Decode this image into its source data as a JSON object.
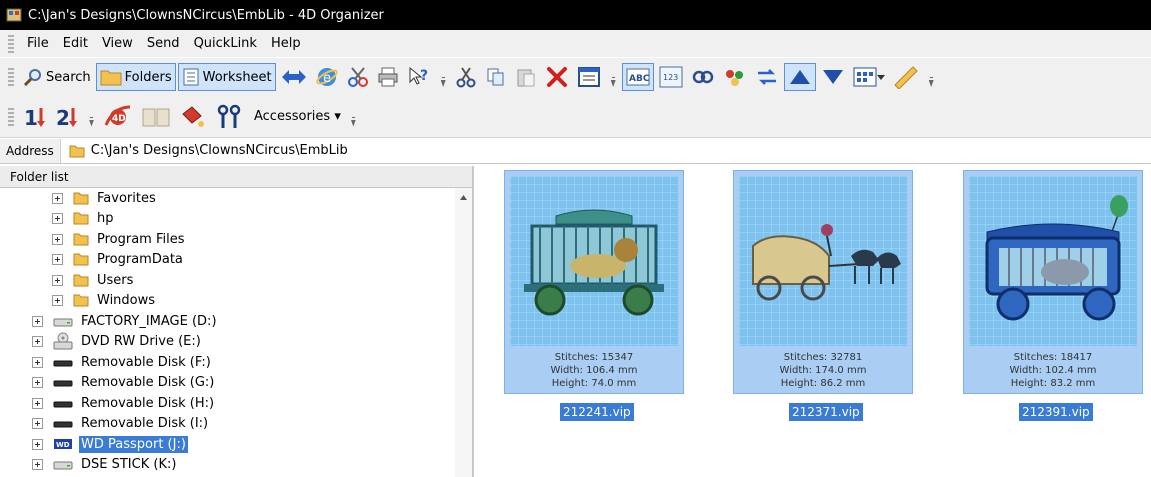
{
  "window": {
    "title": "C:\\Jan's Designs\\ClownsNCircus\\EmbLib - 4D Organizer"
  },
  "menu": [
    "File",
    "Edit",
    "View",
    "Send",
    "QuickLink",
    "Help"
  ],
  "toolbar": {
    "search_label": "Search",
    "folders_label": "Folders",
    "worksheet_label": "Worksheet",
    "accessories_label": "Accessories ▾"
  },
  "address": {
    "label": "Address",
    "value": "C:\\Jan's Designs\\ClownsNCircus\\EmbLib"
  },
  "folder_list": {
    "header": "Folder list",
    "items": [
      {
        "label": "Favorites",
        "icon": "folder-icon"
      },
      {
        "label": "hp",
        "icon": "folder-icon"
      },
      {
        "label": "Program Files",
        "icon": "folder-icon"
      },
      {
        "label": "ProgramData",
        "icon": "folder-icon"
      },
      {
        "label": "Users",
        "icon": "folder-icon"
      },
      {
        "label": "Windows",
        "icon": "folder-icon"
      },
      {
        "label": "FACTORY_IMAGE (D:)",
        "icon": "drive-icon"
      },
      {
        "label": "DVD RW Drive (E:)",
        "icon": "dvd-drive-icon"
      },
      {
        "label": "Removable Disk (F:)",
        "icon": "removable-disk-icon"
      },
      {
        "label": "Removable Disk (G:)",
        "icon": "removable-disk-icon"
      },
      {
        "label": "Removable Disk (H:)",
        "icon": "removable-disk-icon"
      },
      {
        "label": "Removable Disk (I:)",
        "icon": "removable-disk-icon"
      },
      {
        "label": "WD Passport (J:)",
        "icon": "wd-drive-icon",
        "selected": true
      },
      {
        "label": "DSE STICK (K:)",
        "icon": "drive-icon"
      }
    ]
  },
  "designs": [
    {
      "file": "212241.vip",
      "stitches": "Stitches: 15347",
      "width": "Width: 106.4 mm",
      "height": "Height: 74.0 mm",
      "subject": "lion-cage-wagon"
    },
    {
      "file": "212371.vip",
      "stitches": "Stitches: 32781",
      "width": "Width: 174.0 mm",
      "height": "Height: 86.2 mm",
      "subject": "horse-drawn-carriage"
    },
    {
      "file": "212391.vip",
      "stitches": "Stitches: 18417",
      "width": "Width: 102.4 mm",
      "height": "Height: 83.2 mm",
      "subject": "elephant-cage-wagon"
    }
  ],
  "colors": {
    "selection": "#3a7bd5",
    "thumb_bg": "#a9cdf3",
    "titlebar": "#000000"
  }
}
